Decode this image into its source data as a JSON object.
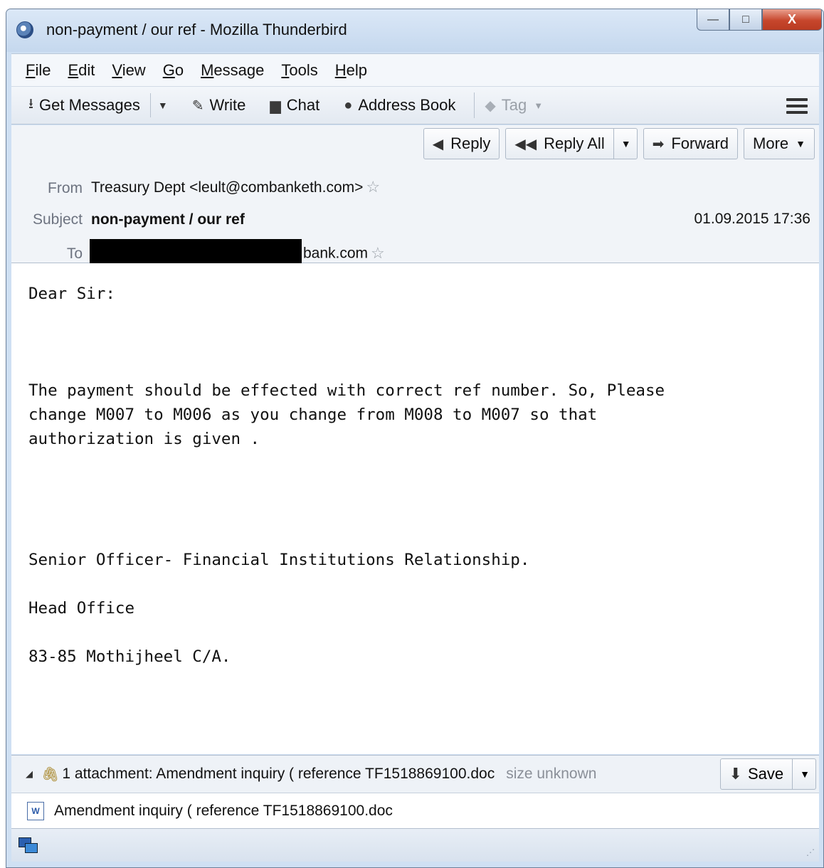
{
  "window": {
    "title": "non-payment / our ref - Mozilla Thunderbird",
    "controls": {
      "minimize": "—",
      "maximize": "□",
      "close": "X"
    }
  },
  "menu": [
    {
      "label": "File",
      "accel": "F",
      "rest": "ile"
    },
    {
      "label": "Edit",
      "accel": "E",
      "rest": "dit"
    },
    {
      "label": "View",
      "accel": "V",
      "rest": "iew"
    },
    {
      "label": "Go",
      "accel": "G",
      "rest": "o"
    },
    {
      "label": "Message",
      "accel": "M",
      "rest": "essage"
    },
    {
      "label": "Tools",
      "accel": "T",
      "rest": "ools"
    },
    {
      "label": "Help",
      "accel": "H",
      "rest": "elp"
    }
  ],
  "toolbar": {
    "get_messages": "Get Messages",
    "write": "Write",
    "chat": "Chat",
    "address_book": "Address Book",
    "tag": "Tag"
  },
  "actions": {
    "reply": "Reply",
    "reply_all": "Reply All",
    "forward": "Forward",
    "more": "More"
  },
  "header": {
    "from_label": "From",
    "from_value": "Treasury Dept <leult@combanketh.com>",
    "subject_label": "Subject",
    "subject_value": "non-payment / our ref",
    "date": "01.09.2015 17:36",
    "to_label": "To",
    "to_value_visible": "bank.com"
  },
  "body": {
    "greeting": "Dear Sir:",
    "paragraph": "The payment should be effected with correct ref number. So, Please\nchange M007 to M006 as you change from M008 to M007 so that\nauthorization is given .",
    "signature_title": "Senior Officer- Financial Institutions Relationship.",
    "signature_office": "Head Office",
    "signature_address": "83-85 Mothijheel C/A."
  },
  "attachments": {
    "summary": "1 attachment: Amendment inquiry ( reference TF1518869100.doc",
    "size": "size unknown",
    "save_label": "Save",
    "items": [
      {
        "name": "Amendment inquiry ( reference TF1518869100.doc"
      }
    ]
  },
  "icons": {
    "get_messages": "download-icon",
    "write": "pencil-icon",
    "chat": "chat-bubble-icon",
    "address_book": "person-icon",
    "tag": "tag-icon",
    "reply": "reply-arrow-icon",
    "reply_all": "reply-all-arrow-icon",
    "forward": "forward-arrow-icon",
    "attachment": "paperclip-icon",
    "doc": "word-document-icon",
    "status": "online-status-icon"
  }
}
